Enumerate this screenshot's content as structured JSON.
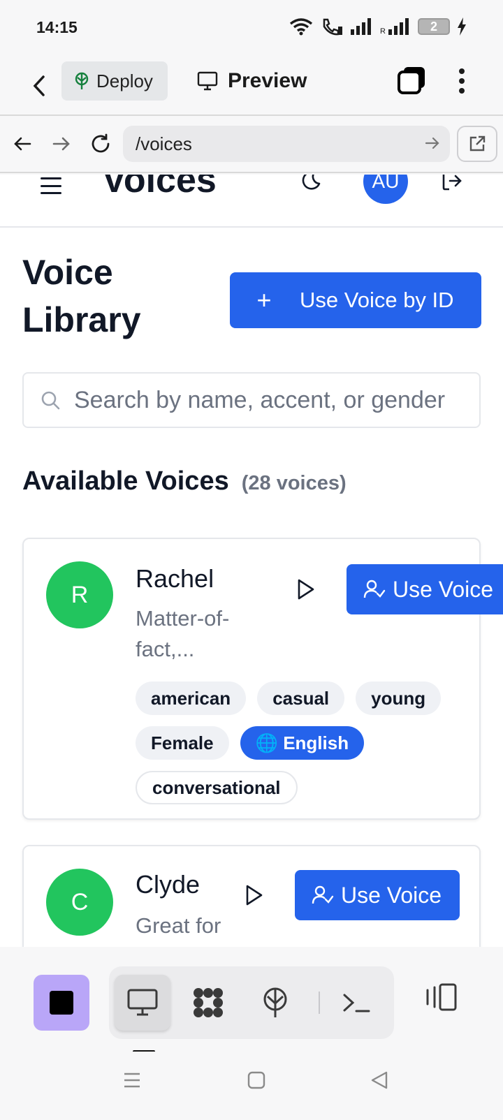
{
  "status": {
    "time": "14:15",
    "battery": "2"
  },
  "toolbar": {
    "deploy_label": "Deploy",
    "preview_label": "Preview"
  },
  "urlbar": {
    "url": "/voices"
  },
  "header": {
    "title": "Voices",
    "avatar_initials": "AU"
  },
  "main": {
    "heading": "Voice Library",
    "use_by_id_label": "Use Voice by ID",
    "search_placeholder": "Search by name, accent, or gender",
    "section_title": "Available Voices",
    "voice_count": "(28 voices)",
    "voices": [
      {
        "initial": "R",
        "name": "Rachel",
        "description": "Matter-of-fact,...",
        "use_label": "Use Voice",
        "tags": [
          "american",
          "casual",
          "young",
          "Female"
        ],
        "language": "🌐 English",
        "use_case": "conversational"
      },
      {
        "initial": "C",
        "name": "Clyde",
        "description": "Great for",
        "use_label": "Use Voice"
      }
    ]
  },
  "colors": {
    "accent": "#2563eb",
    "avatar_green": "#22c55e",
    "stop_purple": "#b9a6f8"
  }
}
